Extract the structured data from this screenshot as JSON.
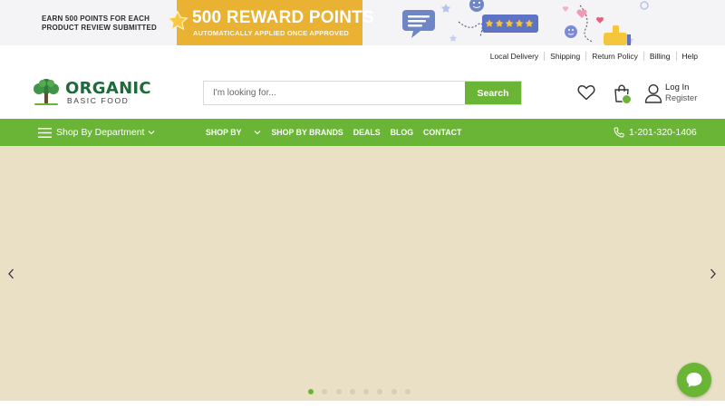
{
  "promo": {
    "left_text": "EARN 500 POINTS FOR EACH PRODUCT REVIEW SUBMITTED",
    "headline": "500 REWARD POINTS",
    "subline": "AUTOMATICALLY APPLIED ONCE APPROVED",
    "accent_color": "#e9b233",
    "rating_stars": 5
  },
  "utility_links": [
    "Local Delivery",
    "Shipping",
    "Return Policy",
    "Billing",
    "Help"
  ],
  "logo": {
    "main": "ORGANIC",
    "sub": "BASIC FOOD"
  },
  "search": {
    "placeholder": "I'm looking for...",
    "button_label": "Search"
  },
  "account": {
    "login_label": "Log In",
    "register_label": "Register"
  },
  "nav": {
    "department_label": "Shop By Department",
    "items": [
      "SHOP BY",
      "SHOP BY BRANDS",
      "DEALS",
      "BLOG",
      "CONTACT"
    ],
    "phone": "1-201-320-1406",
    "bar_color": "#6bb536"
  },
  "hero": {
    "background_color": "#e9e0c6",
    "slide_count": 8,
    "active_slide": 1
  },
  "icons": {
    "wishlist": "heart-icon",
    "cart": "shopping-bag-icon",
    "account": "user-icon",
    "menu": "hamburger-icon",
    "phone": "phone-icon",
    "chat": "chat-bubble-icon"
  }
}
